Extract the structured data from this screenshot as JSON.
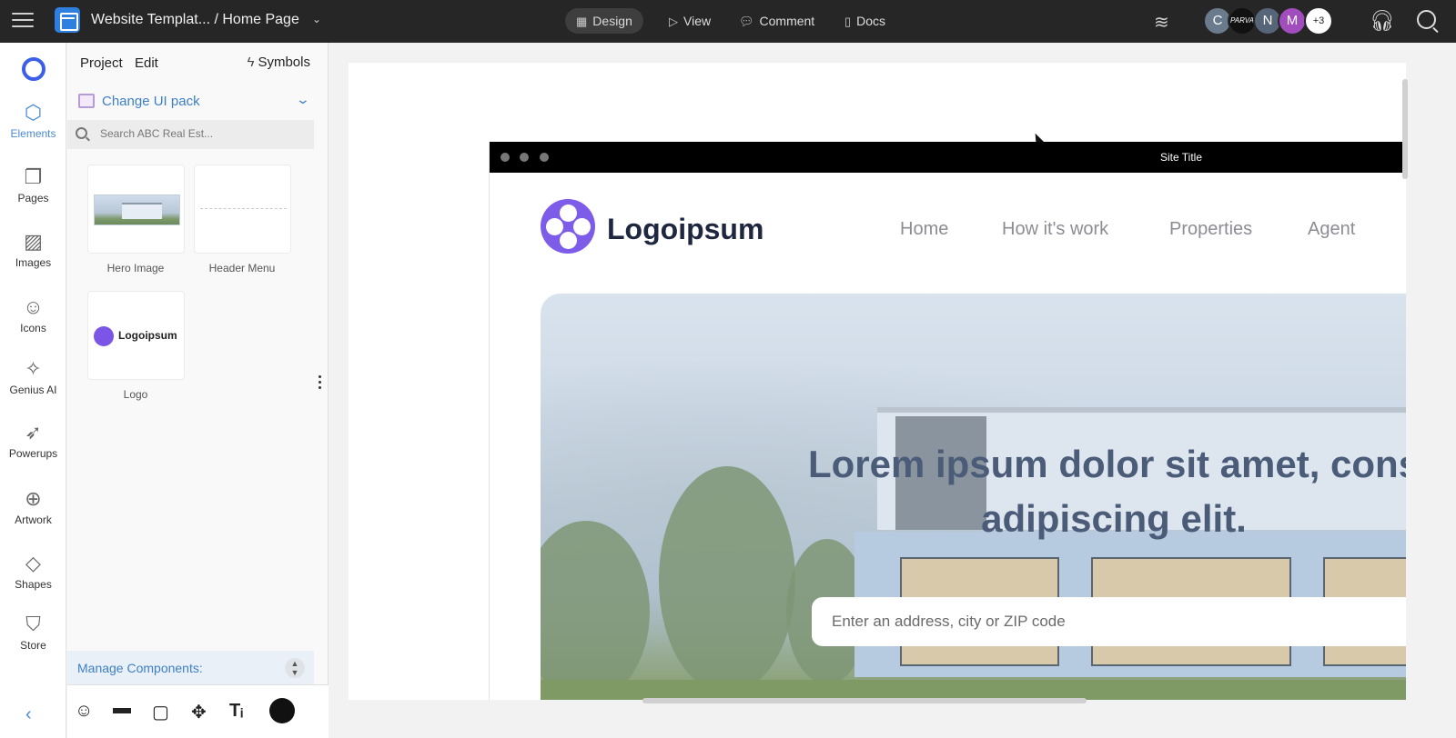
{
  "topbar": {
    "doc_title": "Website Templat... / Home Page",
    "modes": [
      {
        "label": "Design",
        "icon": "layout-icon",
        "active": true
      },
      {
        "label": "View",
        "icon": "play-icon",
        "active": false
      },
      {
        "label": "Comment",
        "icon": "comment-icon",
        "active": false
      },
      {
        "label": "Docs",
        "icon": "document-icon",
        "active": false
      }
    ],
    "avatars": [
      {
        "initial": "C",
        "color": "#6b7b8e"
      },
      {
        "initial": "PARVA",
        "color": "#111111"
      },
      {
        "initial": "N",
        "color": "#566577"
      },
      {
        "initial": "M",
        "color": "#a24dbd"
      },
      {
        "initial": "+3",
        "color": "#ffffff"
      }
    ]
  },
  "rail": {
    "items": [
      {
        "label": "Elements",
        "icon": "cube-icon",
        "active": true
      },
      {
        "label": "Pages",
        "icon": "pages-icon",
        "active": false
      },
      {
        "label": "Images",
        "icon": "image-icon",
        "active": false
      },
      {
        "label": "Icons",
        "icon": "smiley-icon",
        "active": false
      },
      {
        "label": "Genius AI",
        "icon": "sparkle-icon",
        "active": false
      },
      {
        "label": "Powerups",
        "icon": "rocket-icon",
        "active": false
      },
      {
        "label": "Artwork",
        "icon": "basketball-icon",
        "active": false
      },
      {
        "label": "Shapes",
        "icon": "diamond-icon",
        "active": false
      },
      {
        "label": "Store",
        "icon": "bag-icon",
        "active": false
      }
    ]
  },
  "panel": {
    "tabs": [
      "Project",
      "Edit"
    ],
    "symbols_label": "Symbols",
    "ui_pack_label": "Change UI pack",
    "search_placeholder": "Search ABC Real Est...",
    "components": [
      {
        "label": "Hero Image"
      },
      {
        "label": "Header Menu"
      },
      {
        "label": "Logo",
        "thumb_text": "Logoipsum"
      }
    ],
    "manage_label": "Manage Components:"
  },
  "site": {
    "title": "Site Title",
    "brand": "Logoipsum",
    "nav": [
      "Home",
      "How it's work",
      "Properties",
      "Agent"
    ],
    "headline_1": "Lorem ipsum dolor sit amet, cons",
    "headline_2": "adipiscing elit.",
    "search_placeholder": "Enter an address, city or ZIP code"
  },
  "colors": {
    "topbar": "#262626",
    "accent_blue": "#3d7fc6",
    "brand_purple": "#7c5ce8"
  }
}
